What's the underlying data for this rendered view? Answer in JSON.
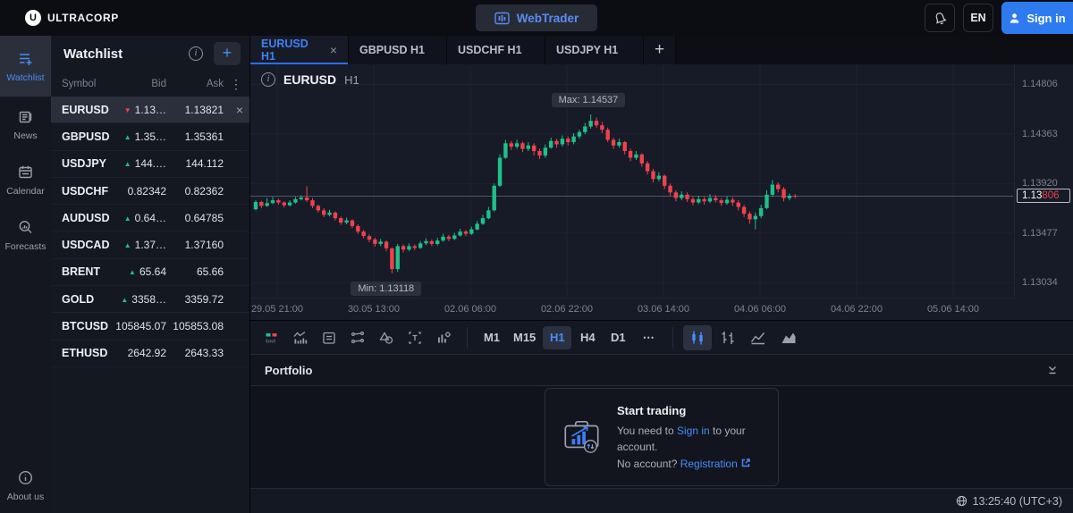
{
  "topbar": {
    "brand": "ULTRACORP",
    "brand_mark": "U",
    "webtrader_label": "WebTrader",
    "language": "EN",
    "signin_label": "Sign in"
  },
  "sidebar": {
    "items": [
      {
        "label": "Watchlist",
        "icon": "watchlist-icon",
        "active": true
      },
      {
        "label": "News",
        "icon": "news-icon",
        "active": false
      },
      {
        "label": "Calendar",
        "icon": "calendar-icon",
        "active": false
      },
      {
        "label": "Forecasts",
        "icon": "forecasts-icon",
        "active": false
      }
    ],
    "about_label": "About us"
  },
  "watchlist": {
    "title": "Watchlist",
    "columns": [
      "Symbol",
      "Bid",
      "Ask"
    ],
    "rows": [
      {
        "symbol": "EURUSD",
        "dir": "down",
        "bid": "1.13…",
        "ask": "1.13821",
        "selected": true,
        "closable": true
      },
      {
        "symbol": "GBPUSD",
        "dir": "up",
        "bid": "1.35…",
        "ask": "1.35361"
      },
      {
        "symbol": "USDJPY",
        "dir": "up",
        "bid": "144.…",
        "ask": "144.112"
      },
      {
        "symbol": "USDCHF",
        "dir": "none",
        "bid": "0.82342",
        "ask": "0.82362"
      },
      {
        "symbol": "AUDUSD",
        "dir": "up",
        "bid": "0.64…",
        "ask": "0.64785"
      },
      {
        "symbol": "USDCAD",
        "dir": "up",
        "bid": "1.37…",
        "ask": "1.37160"
      },
      {
        "symbol": "BRENT",
        "dir": "up",
        "bid": "65.64",
        "ask": "65.66"
      },
      {
        "symbol": "GOLD",
        "dir": "up",
        "bid": "3358…",
        "ask": "3359.72"
      },
      {
        "symbol": "BTCUSD",
        "dir": "none",
        "bid": "105845.07",
        "ask": "105853.08"
      },
      {
        "symbol": "ETHUSD",
        "dir": "none",
        "bid": "2642.92",
        "ask": "2643.33"
      }
    ]
  },
  "tabs": [
    {
      "label": "EURUSD H1",
      "active": true,
      "closable": true
    },
    {
      "label": "GBPUSD H1",
      "active": false,
      "closable": false
    },
    {
      "label": "USDCHF H1",
      "active": false,
      "closable": false
    },
    {
      "label": "USDJPY H1",
      "active": false,
      "closable": false
    }
  ],
  "toolbar": {
    "drawing_tools": [
      "display-mode",
      "indicators",
      "journal",
      "trend-lines",
      "shapes",
      "text-tool",
      "chart-settings"
    ],
    "timeframes": [
      {
        "label": "M1",
        "active": false
      },
      {
        "label": "M15",
        "active": false
      },
      {
        "label": "H1",
        "active": true
      },
      {
        "label": "H4",
        "active": false
      },
      {
        "label": "D1",
        "active": false
      },
      {
        "label": "⋯",
        "active": false
      }
    ],
    "chart_types": [
      {
        "name": "candlestick",
        "active": true
      },
      {
        "name": "bars",
        "active": false
      },
      {
        "name": "line",
        "active": false
      },
      {
        "name": "area",
        "active": false
      }
    ]
  },
  "portfolio": {
    "title": "Portfolio",
    "card": {
      "title": "Start trading",
      "line1_pre": "You need to ",
      "line1_link": "Sign in",
      "line1_post": " to your account.",
      "line2_pre": "No account? ",
      "line2_link": "Registration"
    }
  },
  "statusbar": {
    "clock": "13:25:40 (UTC+3)"
  },
  "chart_data": {
    "type": "candlestick",
    "symbol": "EURUSD",
    "timeframe": "H1",
    "colors": {
      "up": "#1fc08a",
      "down": "#f0414f",
      "grid": "#1e2330",
      "price_line": "#9aa0ab"
    },
    "view": {
      "price_top": 1.14985,
      "price_bottom": 1.129
    },
    "y_ticks": [
      1.14806,
      1.14363,
      1.1392,
      1.13477,
      1.13034
    ],
    "x_ticks": [
      "29.05 21:00",
      "30.05 13:00",
      "02.06 06:00",
      "02.06 22:00",
      "03.06 14:00",
      "04.06 06:00",
      "04.06 22:00",
      "05.06 14:00"
    ],
    "current_price": 1.13806,
    "current_price_main": "1.13",
    "current_price_accent": "806",
    "max_label": "Max: 1.14537",
    "max_value": 1.14537,
    "max_index": 59,
    "min_label": "Min: 1.13118",
    "min_value": 1.13118,
    "min_index": 24,
    "candles": [
      [
        1.1369,
        1.1377,
        1.1368,
        1.13755
      ],
      [
        1.13755,
        1.13765,
        1.137,
        1.1372
      ],
      [
        1.1372,
        1.1379,
        1.1371,
        1.13745
      ],
      [
        1.13745,
        1.138,
        1.13735,
        1.1377
      ],
      [
        1.1377,
        1.13785,
        1.1373,
        1.1375
      ],
      [
        1.1375,
        1.1376,
        1.13705,
        1.13725
      ],
      [
        1.13725,
        1.1377,
        1.13715,
        1.1375
      ],
      [
        1.1375,
        1.138,
        1.1374,
        1.1378
      ],
      [
        1.1378,
        1.13815,
        1.1377,
        1.13795
      ],
      [
        1.13795,
        1.13895,
        1.13755,
        1.1377
      ],
      [
        1.1377,
        1.1379,
        1.137,
        1.1372
      ],
      [
        1.1372,
        1.1373,
        1.1366,
        1.1368
      ],
      [
        1.1368,
        1.137,
        1.1362,
        1.1364
      ],
      [
        1.1364,
        1.13685,
        1.13625,
        1.1366
      ],
      [
        1.1366,
        1.1367,
        1.1359,
        1.1361
      ],
      [
        1.1361,
        1.13625,
        1.1355,
        1.1357
      ],
      [
        1.1357,
        1.13615,
        1.13555,
        1.1359
      ],
      [
        1.1359,
        1.136,
        1.1352,
        1.1354
      ],
      [
        1.1354,
        1.13555,
        1.1347,
        1.1349
      ],
      [
        1.1349,
        1.13505,
        1.1343,
        1.1345
      ],
      [
        1.1345,
        1.13465,
        1.13395,
        1.1342
      ],
      [
        1.1342,
        1.13435,
        1.13355,
        1.1338
      ],
      [
        1.1338,
        1.13425,
        1.1336,
        1.134
      ],
      [
        1.134,
        1.1341,
        1.13315,
        1.1334
      ],
      [
        1.1334,
        1.1335,
        1.13118,
        1.13155
      ],
      [
        1.13155,
        1.1338,
        1.1313,
        1.1336
      ],
      [
        1.1336,
        1.13375,
        1.13305,
        1.1333
      ],
      [
        1.1333,
        1.13385,
        1.13315,
        1.1336
      ],
      [
        1.1336,
        1.13375,
        1.13325,
        1.13345
      ],
      [
        1.13345,
        1.13405,
        1.13335,
        1.13385
      ],
      [
        1.13385,
        1.1343,
        1.1337,
        1.13405
      ],
      [
        1.13405,
        1.1342,
        1.1336,
        1.1338
      ],
      [
        1.1338,
        1.13435,
        1.13365,
        1.1341
      ],
      [
        1.1341,
        1.1347,
        1.134,
        1.13445
      ],
      [
        1.13445,
        1.1346,
        1.13405,
        1.13425
      ],
      [
        1.13425,
        1.1348,
        1.13415,
        1.13455
      ],
      [
        1.13455,
        1.13515,
        1.13445,
        1.1349
      ],
      [
        1.1349,
        1.13505,
        1.1345,
        1.1347
      ],
      [
        1.1347,
        1.13535,
        1.1346,
        1.1351
      ],
      [
        1.1351,
        1.13585,
        1.135,
        1.1356
      ],
      [
        1.1356,
        1.1364,
        1.1355,
        1.1361
      ],
      [
        1.1361,
        1.1371,
        1.136,
        1.1368
      ],
      [
        1.1368,
        1.1392,
        1.1367,
        1.139
      ],
      [
        1.139,
        1.1418,
        1.1389,
        1.1415
      ],
      [
        1.1415,
        1.1431,
        1.1414,
        1.1428
      ],
      [
        1.1428,
        1.143,
        1.1422,
        1.1425
      ],
      [
        1.1425,
        1.1431,
        1.1423,
        1.1428
      ],
      [
        1.1428,
        1.14295,
        1.142,
        1.1423
      ],
      [
        1.1423,
        1.1429,
        1.1421,
        1.1426
      ],
      [
        1.1426,
        1.1428,
        1.1417,
        1.1421
      ],
      [
        1.1421,
        1.1423,
        1.1414,
        1.1417
      ],
      [
        1.1417,
        1.1427,
        1.1415,
        1.1424
      ],
      [
        1.1424,
        1.1433,
        1.1423,
        1.143
      ],
      [
        1.143,
        1.1432,
        1.1424,
        1.1427
      ],
      [
        1.1427,
        1.1435,
        1.1425,
        1.1432
      ],
      [
        1.1432,
        1.1434,
        1.1426,
        1.1429
      ],
      [
        1.1429,
        1.1437,
        1.1427,
        1.1434
      ],
      [
        1.1434,
        1.144,
        1.1432,
        1.1438
      ],
      [
        1.1438,
        1.1446,
        1.1436,
        1.1443
      ],
      [
        1.1443,
        1.14537,
        1.1441,
        1.1448
      ],
      [
        1.1448,
        1.1451,
        1.1442,
        1.1444
      ],
      [
        1.1444,
        1.1447,
        1.1437,
        1.144
      ],
      [
        1.144,
        1.1442,
        1.1429,
        1.1431
      ],
      [
        1.1431,
        1.1433,
        1.1423,
        1.1426
      ],
      [
        1.1426,
        1.1432,
        1.1424,
        1.1429
      ],
      [
        1.1429,
        1.143,
        1.1418,
        1.1421
      ],
      [
        1.1421,
        1.1423,
        1.1412,
        1.1415
      ],
      [
        1.1415,
        1.1421,
        1.1413,
        1.1418
      ],
      [
        1.1418,
        1.1419,
        1.1407,
        1.141
      ],
      [
        1.141,
        1.1412,
        1.14,
        1.1403
      ],
      [
        1.1403,
        1.1405,
        1.1393,
        1.1396
      ],
      [
        1.1396,
        1.1402,
        1.1394,
        1.1399
      ],
      [
        1.1399,
        1.14,
        1.1387,
        1.139
      ],
      [
        1.139,
        1.1392,
        1.1381,
        1.1384
      ],
      [
        1.1384,
        1.1386,
        1.1376,
        1.1379
      ],
      [
        1.1379,
        1.1385,
        1.1377,
        1.1382
      ],
      [
        1.1382,
        1.1384,
        1.13755,
        1.1378
      ],
      [
        1.1378,
        1.138,
        1.13725,
        1.1375
      ],
      [
        1.1375,
        1.1381,
        1.13735,
        1.1378
      ],
      [
        1.1378,
        1.138,
        1.1373,
        1.1376
      ],
      [
        1.1376,
        1.13825,
        1.13745,
        1.1379
      ],
      [
        1.1379,
        1.13815,
        1.1375,
        1.1377
      ],
      [
        1.1377,
        1.1379,
        1.1372,
        1.13745
      ],
      [
        1.13745,
        1.13805,
        1.1373,
        1.13775
      ],
      [
        1.13775,
        1.13795,
        1.1372,
        1.1375
      ],
      [
        1.1375,
        1.1377,
        1.1368,
        1.1371
      ],
      [
        1.1371,
        1.1373,
        1.1362,
        1.1365
      ],
      [
        1.1365,
        1.1367,
        1.1356,
        1.136
      ],
      [
        1.136,
        1.1366,
        1.1351,
        1.1363
      ],
      [
        1.1363,
        1.1373,
        1.1361,
        1.137
      ],
      [
        1.137,
        1.1386,
        1.1369,
        1.1382
      ],
      [
        1.1382,
        1.1395,
        1.138,
        1.1391
      ],
      [
        1.1391,
        1.1393,
        1.1384,
        1.1387
      ],
      [
        1.1387,
        1.1389,
        1.1376,
        1.1379
      ],
      [
        1.1379,
        1.1383,
        1.1377,
        1.1381
      ],
      [
        1.1381,
        1.13825,
        1.1379,
        1.13806
      ]
    ]
  }
}
